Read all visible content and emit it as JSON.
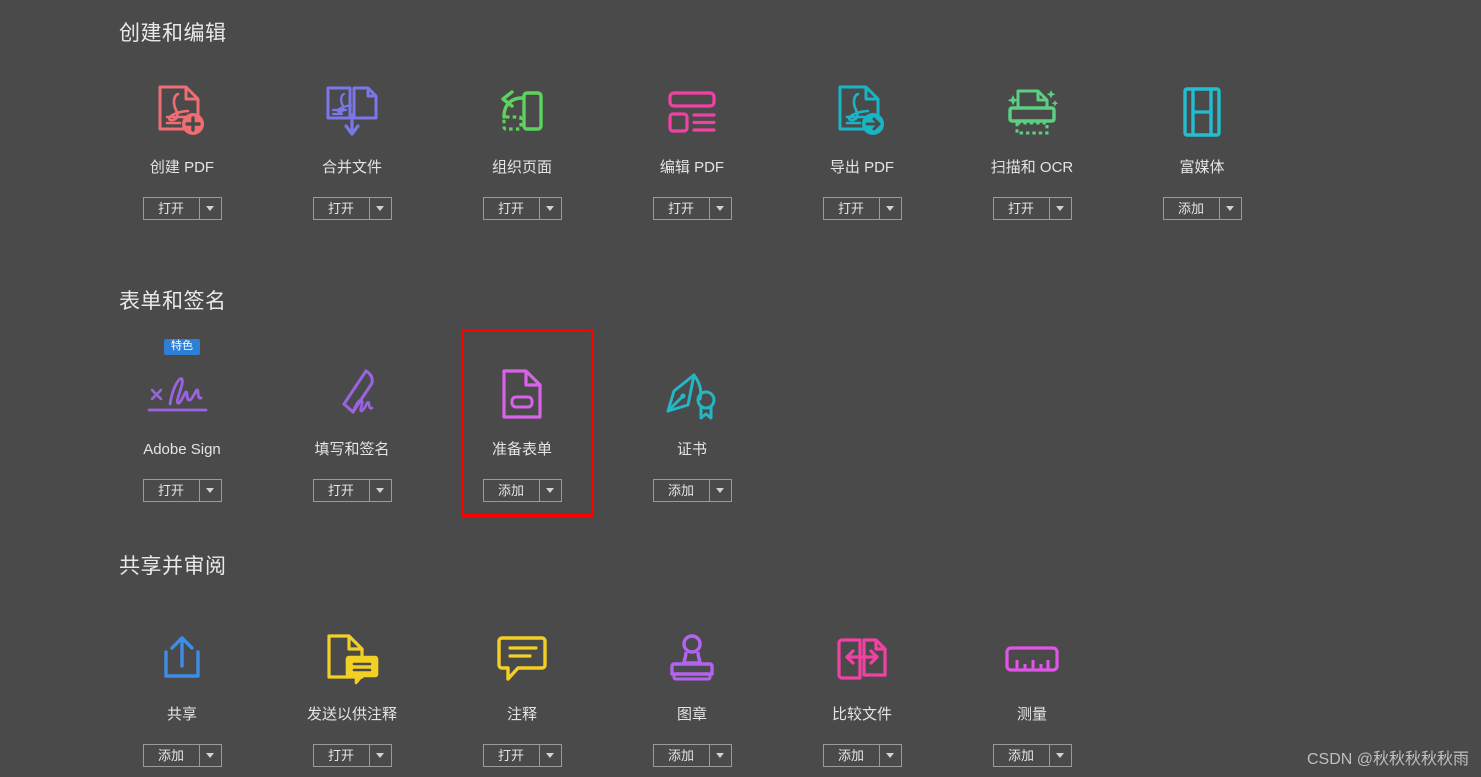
{
  "background_color": "#4a4a4a",
  "watermark": "CSDN @秋秋秋秋秋雨",
  "highlight": {
    "color": "#fe0000",
    "target_tool": "准备表单"
  },
  "sections": [
    {
      "id": "create-and-edit",
      "title": "创建和编辑",
      "tools": [
        {
          "name": "创建 PDF",
          "icon": "create-pdf-icon",
          "color": "#ef6e73",
          "button": "打开",
          "badge": null
        },
        {
          "name": "合并文件",
          "icon": "combine-files-icon",
          "color": "#7b77e8",
          "button": "打开",
          "badge": null
        },
        {
          "name": "组织页面",
          "icon": "organize-pages-icon",
          "color": "#5cd35c",
          "button": "打开",
          "badge": null
        },
        {
          "name": "编辑 PDF",
          "icon": "edit-pdf-icon",
          "color": "#f241a4",
          "button": "打开",
          "badge": null
        },
        {
          "name": "导出 PDF",
          "icon": "export-pdf-icon",
          "color": "#19b5c4",
          "button": "打开",
          "badge": null
        },
        {
          "name": "扫描和 OCR",
          "icon": "scan-ocr-icon",
          "color": "#5bd083",
          "button": "打开",
          "badge": null
        },
        {
          "name": "富媒体",
          "icon": "rich-media-icon",
          "color": "#25bcd0",
          "button": "添加",
          "badge": null
        }
      ]
    },
    {
      "id": "forms-and-signatures",
      "title": "表单和签名",
      "tools": [
        {
          "name": "Adobe Sign",
          "icon": "adobe-sign-icon",
          "color": "#9a63e0",
          "button": "打开",
          "badge": "特色"
        },
        {
          "name": "填写和签名",
          "icon": "fill-and-sign-icon",
          "color": "#9a63e0",
          "button": "打开",
          "badge": null
        },
        {
          "name": "准备表单",
          "icon": "prepare-form-icon",
          "color": "#d963e8",
          "button": "添加",
          "badge": null
        },
        {
          "name": "证书",
          "icon": "certificate-icon",
          "color": "#25b5c4",
          "button": "添加",
          "badge": null
        }
      ]
    },
    {
      "id": "share-and-review",
      "title": "共享并审阅",
      "tools": [
        {
          "name": "共享",
          "icon": "share-icon",
          "color": "#3c8ce8",
          "button": "添加",
          "badge": null
        },
        {
          "name": "发送以供注释",
          "icon": "send-for-comments-icon",
          "color": "#f2d024",
          "button": "打开",
          "badge": null
        },
        {
          "name": "注释",
          "icon": "comment-icon",
          "color": "#f2d024",
          "button": "打开",
          "badge": null
        },
        {
          "name": "图章",
          "icon": "stamp-icon",
          "color": "#b463f0",
          "button": "添加",
          "badge": null
        },
        {
          "name": "比较文件",
          "icon": "compare-files-icon",
          "color": "#f241a4",
          "button": "添加",
          "badge": null
        },
        {
          "name": "测量",
          "icon": "measure-icon",
          "color": "#e055e8",
          "button": "添加",
          "badge": null
        }
      ]
    }
  ]
}
